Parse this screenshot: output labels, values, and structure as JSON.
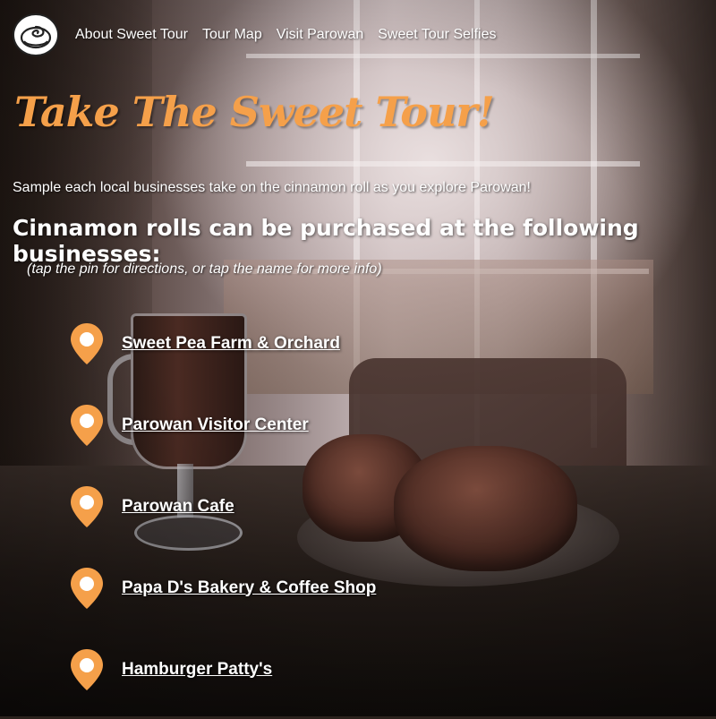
{
  "colors": {
    "accent": "#f5a04a",
    "text": "#ffffff"
  },
  "nav": {
    "logo_icon": "cinnamon-roll-icon",
    "links": [
      {
        "label": "About Sweet Tour"
      },
      {
        "label": "Tour Map"
      },
      {
        "label": "Visit Parowan"
      },
      {
        "label": "Sweet Tour Selfies"
      }
    ]
  },
  "hero": {
    "title": "Take The Sweet Tour!",
    "intro": "Sample each local businesses take on the cinnamon roll as you explore Parowan!",
    "subhead": "Cinnamon rolls can be purchased at the following businesses:",
    "hint": "(tap the pin for directions, or tap the name for more info)"
  },
  "businesses": [
    {
      "name": "Sweet Pea Farm & Orchard",
      "icon": "map-pin-icon"
    },
    {
      "name": "Parowan Visitor Center",
      "icon": "map-pin-icon"
    },
    {
      "name": "Parowan Cafe",
      "icon": "map-pin-icon"
    },
    {
      "name": "Papa D's Bakery & Coffee Shop",
      "icon": "map-pin-icon"
    },
    {
      "name": "Hamburger Patty's",
      "icon": "map-pin-icon"
    }
  ]
}
